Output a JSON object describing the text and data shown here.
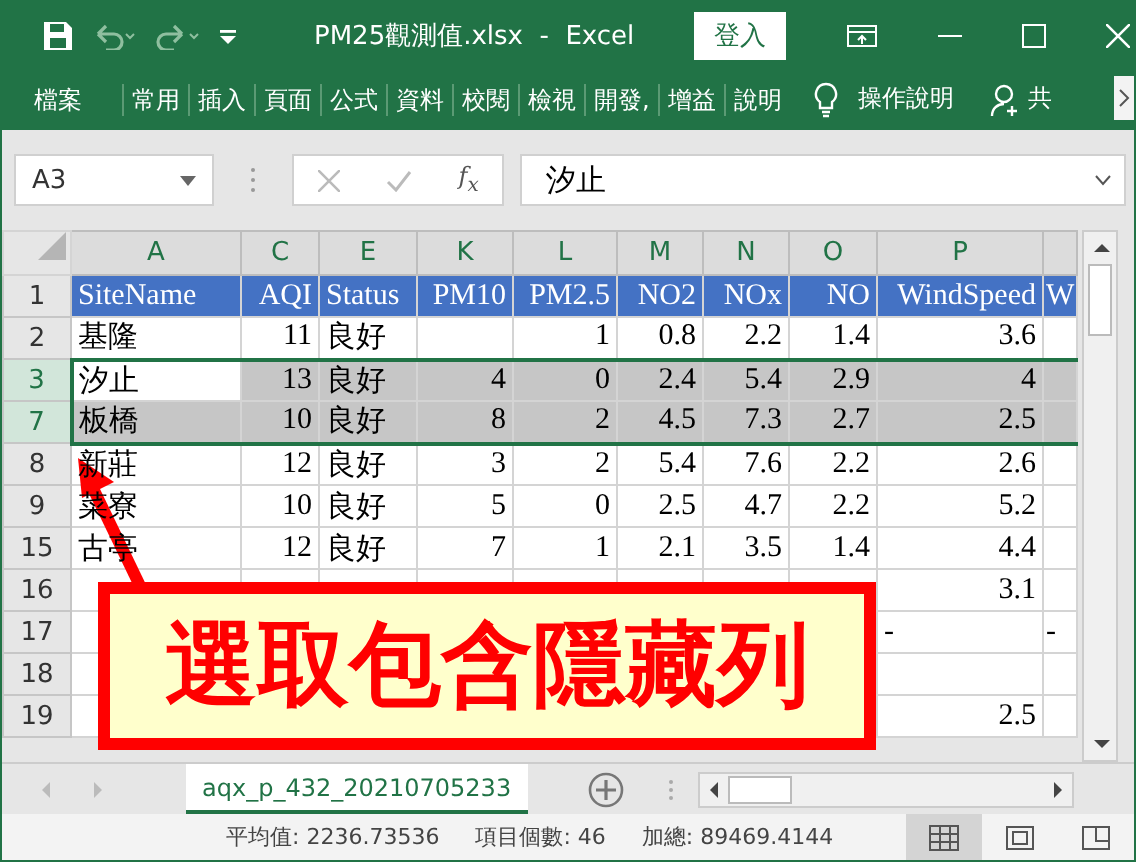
{
  "title_bar": {
    "title": "PM25觀測值.xlsx  -  Excel",
    "sign_in": "登入"
  },
  "ribbon": {
    "tabs": [
      "檔案",
      "常用",
      "插入",
      "頁面",
      "公式",
      "資料",
      "校閱",
      "檢視",
      "開發,",
      "增益",
      "說明"
    ],
    "tell_me": "操作說明",
    "share": "共"
  },
  "formula_bar": {
    "name_box": "A3",
    "function_label": "f$_{x}$",
    "formula": "汐止"
  },
  "columns": [
    "A",
    "C",
    "E",
    "K",
    "L",
    "M",
    "N",
    "O",
    "P"
  ],
  "rows": [
    {
      "header": "1",
      "kind": "header",
      "selected": false,
      "cells": [
        "SiteName",
        "AQI",
        "Status",
        "PM10",
        "PM2.5",
        "NO2",
        "NOx",
        "NO",
        "WindSpeed",
        "W"
      ]
    },
    {
      "header": "2",
      "kind": "data",
      "selected": false,
      "cells": [
        "基隆",
        "11",
        "良好",
        null,
        "1",
        "0.8",
        "2.2",
        "1.4",
        "3.6",
        null
      ]
    },
    {
      "header": "3",
      "kind": "data",
      "selected": true,
      "cells": [
        {
          "text": "汐止",
          "active": true
        },
        "13",
        "良好",
        "4",
        "0",
        "2.4",
        "5.4",
        "2.9",
        "4",
        null
      ]
    },
    {
      "header": "7",
      "kind": "data",
      "selected": true,
      "cells": [
        "板橋",
        "10",
        "良好",
        "8",
        "2",
        "4.5",
        "7.3",
        "2.7",
        "2.5",
        null
      ]
    },
    {
      "header": "8",
      "kind": "data",
      "selected": false,
      "cells": [
        "新莊",
        "12",
        "良好",
        "3",
        "2",
        "5.4",
        "7.6",
        "2.2",
        "2.6",
        null
      ]
    },
    {
      "header": "9",
      "kind": "data",
      "selected": false,
      "cells": [
        "菜寮",
        "10",
        "良好",
        "5",
        "0",
        "2.5",
        "4.7",
        "2.2",
        "5.2",
        null
      ]
    },
    {
      "header": "15",
      "kind": "data",
      "selected": false,
      "cells": [
        "古亭",
        "12",
        "良好",
        "7",
        "1",
        "2.1",
        "3.5",
        "1.4",
        "4.4",
        null
      ]
    },
    {
      "header": "16",
      "kind": "data",
      "selected": false,
      "cells": [
        null,
        null,
        null,
        null,
        null,
        null,
        null,
        null,
        "3.1",
        null
      ]
    },
    {
      "header": "17",
      "kind": "data",
      "selected": false,
      "cells": [
        null,
        null,
        null,
        null,
        null,
        null,
        null,
        null,
        {
          "text": "-",
          "kind": "text"
        },
        "-"
      ]
    },
    {
      "header": "18",
      "kind": "data",
      "selected": false,
      "cells": [
        null,
        null,
        null,
        null,
        null,
        null,
        null,
        null,
        null,
        null
      ]
    },
    {
      "header": "19",
      "kind": "data",
      "selected": false,
      "cells": [
        null,
        null,
        null,
        null,
        null,
        null,
        null,
        null,
        "2.5",
        null
      ]
    }
  ],
  "sheet_tabs": [
    {
      "label": "aqx_p_432_20210705233",
      "selected": true
    }
  ],
  "status_bar": {
    "items": [
      "平均值: 2236.73536",
      "項目個數: 46",
      "加總: 89469.4144"
    ],
    "views": [
      {
        "kind": "normal",
        "selected": true
      },
      {
        "kind": "page_layout",
        "selected": false
      },
      {
        "kind": "page_break",
        "selected": false
      }
    ]
  },
  "callout": {
    "text": "選取包含隱藏列"
  }
}
